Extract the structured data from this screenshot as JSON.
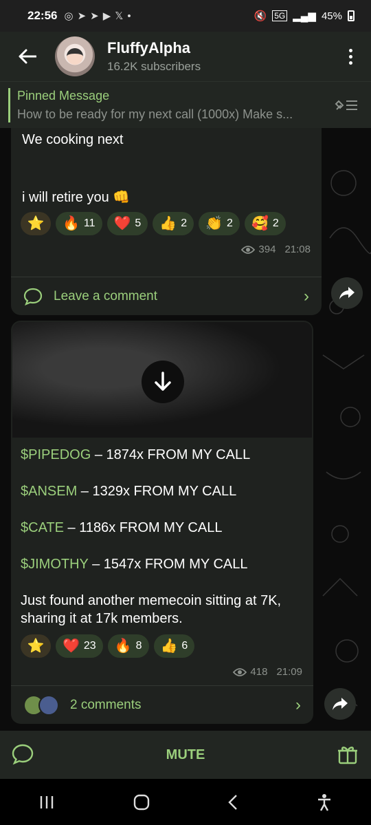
{
  "status_bar": {
    "time": "22:56",
    "left_icons": [
      "whatsapp-icon",
      "telegram-icon",
      "telegram-icon",
      "youtube-icon",
      "x-icon",
      "dot"
    ],
    "network": "5G",
    "battery": "45%"
  },
  "header": {
    "channel_name": "FluffyAlpha",
    "subscribers": "16.2K subscribers"
  },
  "pinned": {
    "label": "Pinned Message",
    "text": "How to be ready for my next call (1000x)  Make s..."
  },
  "messages": [
    {
      "line1": "We cooking next",
      "line2": "i will retire you 👊",
      "reactions": [
        {
          "emoji": "⭐",
          "count": ""
        },
        {
          "emoji": "🔥",
          "count": "11"
        },
        {
          "emoji": "❤️",
          "count": "5"
        },
        {
          "emoji": "👍",
          "count": "2"
        },
        {
          "emoji": "👏",
          "count": "2"
        },
        {
          "emoji": "🥰",
          "count": "2"
        }
      ],
      "views": "394",
      "time": "21:08",
      "comment_label": "Leave a comment"
    },
    {
      "lines": [
        {
          "ticker": "$PIPEDOG",
          "rest": " – 1874x FROM MY CALL"
        },
        {
          "ticker": "$ANSEM",
          "rest": " – 1329x FROM MY CALL"
        },
        {
          "ticker": "$CATE",
          "rest": " – 1186x FROM MY CALL"
        },
        {
          "ticker": "$JIMOTHY",
          "rest": " – 1547x FROM MY CALL"
        }
      ],
      "body": "Just found another memecoin sitting at 7K, sharing it at 17k members.",
      "reactions": [
        {
          "emoji": "⭐",
          "count": ""
        },
        {
          "emoji": "❤️",
          "count": "23"
        },
        {
          "emoji": "🔥",
          "count": "8"
        },
        {
          "emoji": "👍",
          "count": "6"
        }
      ],
      "views": "418",
      "time": "21:09",
      "comment_label": "2 comments"
    }
  ],
  "bottom_bar": {
    "mute_label": "MUTE"
  },
  "colors": {
    "accent": "#9bcf7c",
    "bubble": "#1f221f",
    "header": "#222622"
  }
}
